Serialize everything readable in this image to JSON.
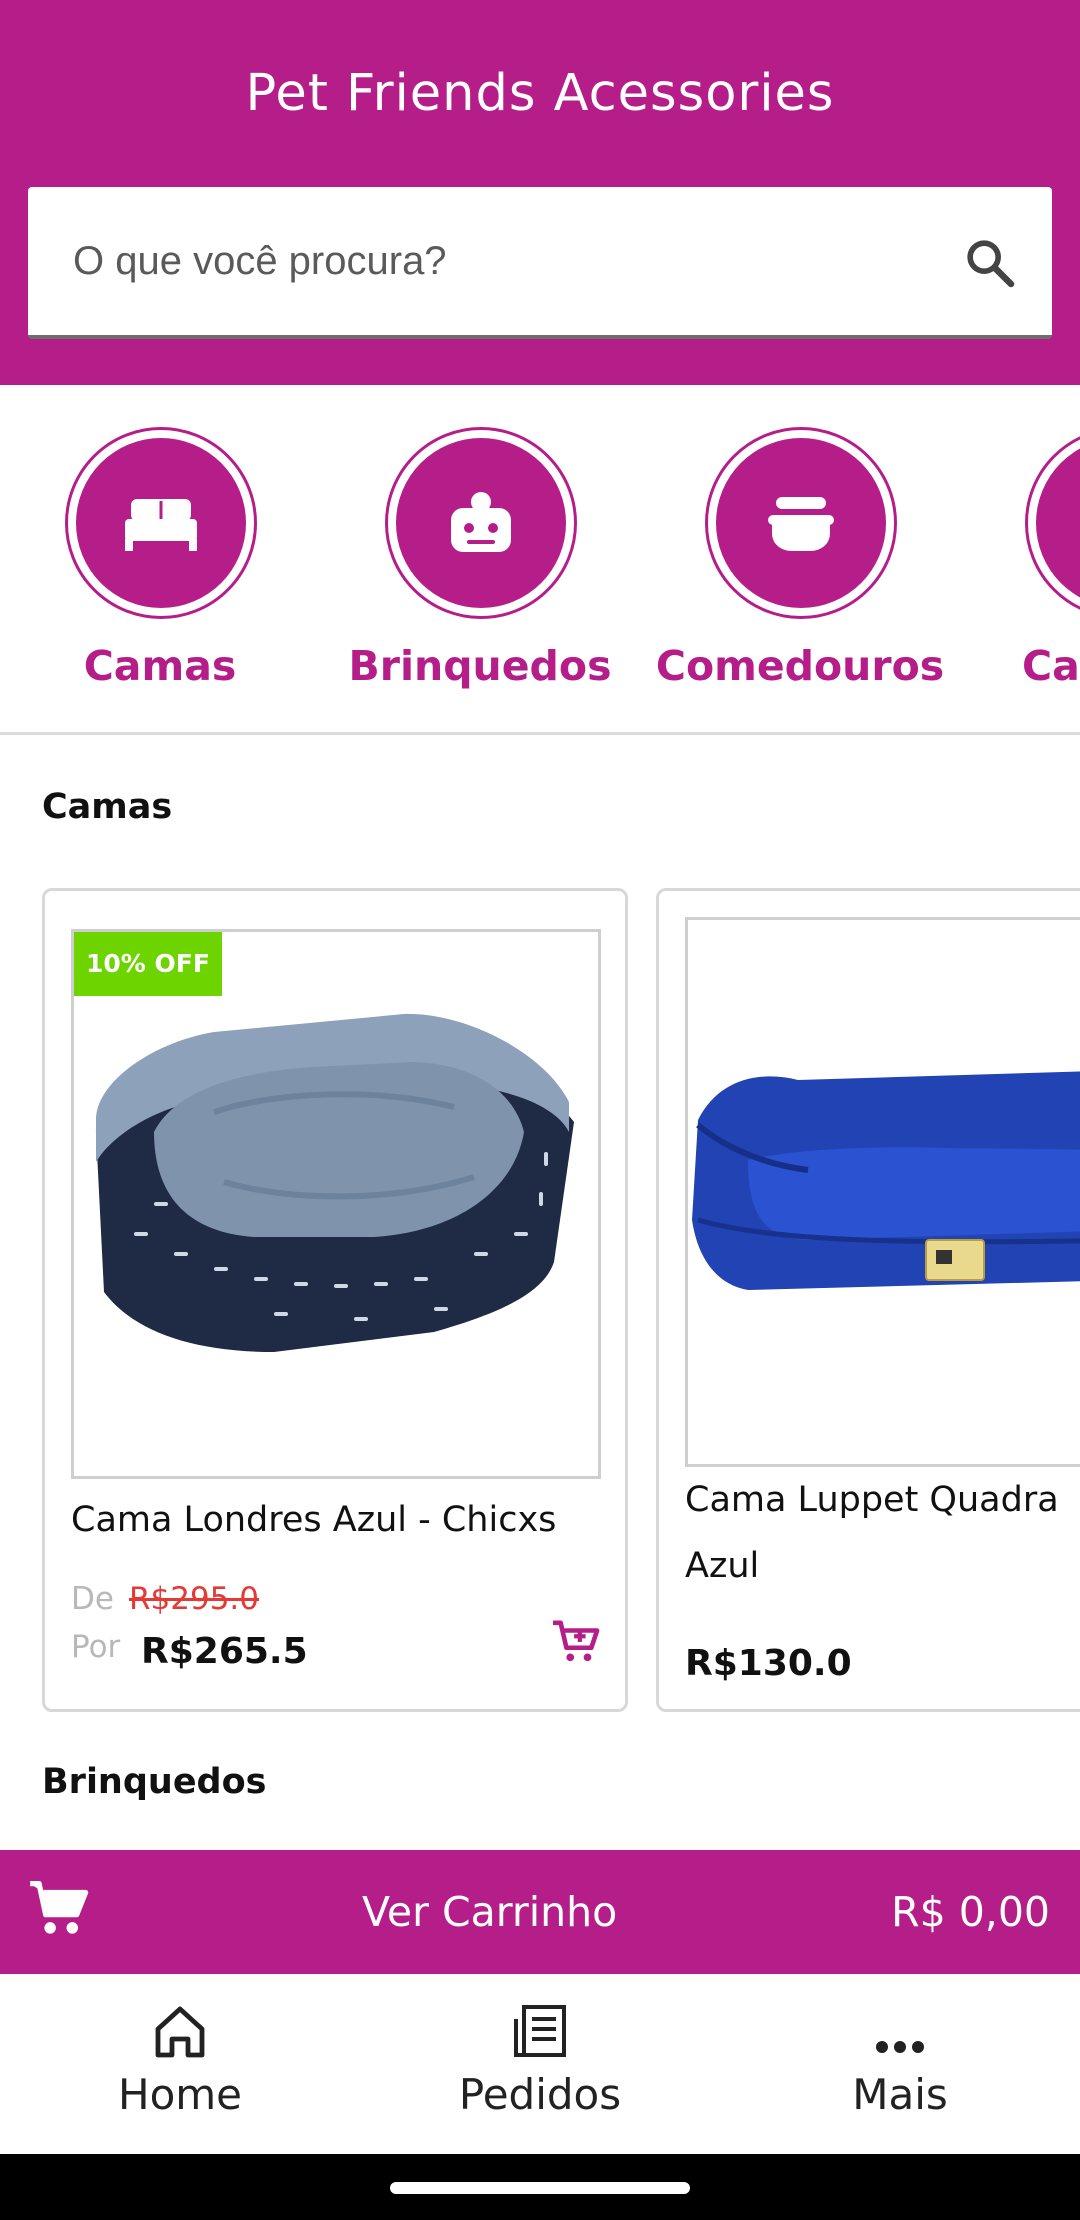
{
  "header": {
    "title": "Pet Friends Acessories",
    "search_placeholder": "O que você procura?",
    "search_icon": "search-icon"
  },
  "categories": [
    {
      "label": "Camas",
      "icon": "bed-icon"
    },
    {
      "label": "Brinquedos",
      "icon": "toy-robot-icon"
    },
    {
      "label": "Comedouros",
      "icon": "food-bowl-icon"
    },
    {
      "label": "Ca",
      "icon": "category-icon"
    }
  ],
  "sections": {
    "camas_title": "Camas",
    "brinquedos_title": "Brinquedos"
  },
  "products": [
    {
      "badge": "10% OFF",
      "name": "Cama Londres Azul - Chicxs",
      "de_label": "De",
      "old_price": "R$295.0",
      "por_label": "Por",
      "price": "R$265.5"
    },
    {
      "name_line1": "Cama Luppet Quadra",
      "name_line2": "Azul",
      "price": "R$130.0"
    }
  ],
  "cart_bar": {
    "label": "Ver Carrinho",
    "total": "R$ 0,00"
  },
  "bottom_nav": [
    {
      "label": "Home",
      "icon": "home-icon"
    },
    {
      "label": "Pedidos",
      "icon": "orders-icon"
    },
    {
      "label": "Mais",
      "icon": "more-icon"
    }
  ],
  "colors": {
    "brand": "#b51d88",
    "badge": "#6dd400",
    "old_price": "#e53935"
  }
}
